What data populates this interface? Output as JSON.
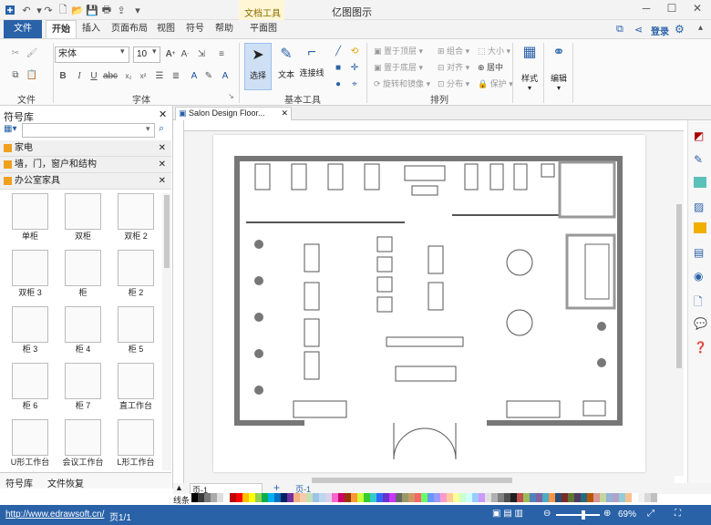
{
  "window": {
    "title": "亿图图示",
    "context_tab": "文档工具"
  },
  "ribbon_tabs": {
    "file": "文件",
    "home": "开始",
    "insert": "插入",
    "page_layout": "页面布局",
    "view": "视图",
    "symbol": "符号",
    "help": "帮助",
    "plan": "平面图"
  },
  "account": {
    "login": "登录"
  },
  "font": {
    "family": "宋体",
    "size": "10"
  },
  "groups": {
    "file": "文件",
    "font": "字体",
    "basic_tools": "基本工具",
    "arrange": "排列"
  },
  "tools": {
    "select": "选择",
    "text": "文本",
    "connector": "连接线",
    "style": "样式",
    "edit": "编辑"
  },
  "arrange": {
    "to_top": "置于顶层",
    "to_bottom": "置于底层",
    "rotate": "旋转和镜像",
    "group": "组合",
    "align": "对齐",
    "distribute": "分布",
    "size": "大小",
    "center": "居中",
    "protect": "保护"
  },
  "sidebar": {
    "title": "符号库",
    "categories": [
      "家电",
      "墙，门，窗户和结构",
      "办公室家具"
    ],
    "symbols": [
      "单柜",
      "双柜",
      "双柜 2",
      "双柜 3",
      "柜",
      "柜 2",
      "柜 3",
      "柜 4",
      "柜 5",
      "柜 6",
      "柜 7",
      "直工作台",
      "U形工作台",
      "会议工作台",
      "L形工作台"
    ],
    "tabs": [
      "符号库",
      "文件恢复"
    ]
  },
  "document": {
    "tab_title": "Salon Design Floor..."
  },
  "pages": {
    "page_tab": "页-1",
    "current": "页-1"
  },
  "palette": {
    "label": "线条"
  },
  "status": {
    "url": "http://www.edrawsoft.cn/",
    "page": "页1/1",
    "zoom": "69%"
  },
  "colors": {
    "accent": "#2a62a8",
    "context": "#fff6d6"
  }
}
